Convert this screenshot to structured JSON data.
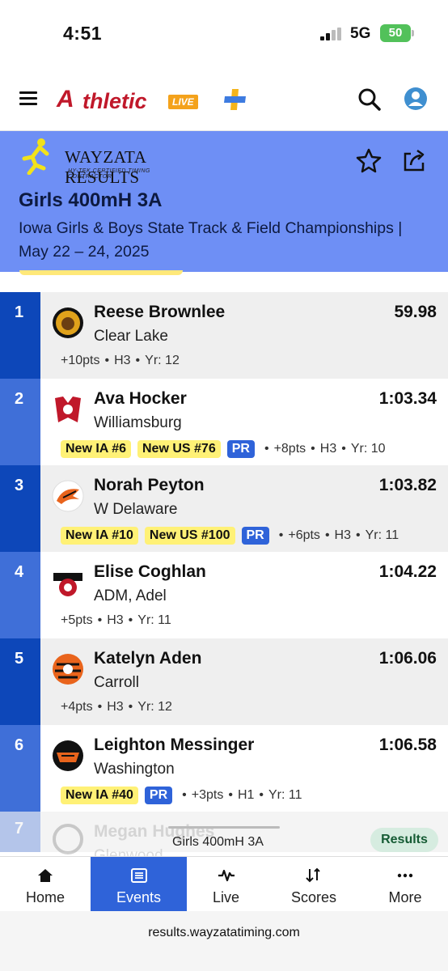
{
  "status_bar": {
    "time": "4:51",
    "network": "5G",
    "battery": "50"
  },
  "app": {
    "logo_a": "A",
    "logo_thletic": "thletic",
    "logo_live": "LIVE"
  },
  "banner": {
    "provider_name": "WAYZATA RESULTS",
    "provider_tagline": "HY-TEK CERTIFIED TIMING CONTRACTOR",
    "event_title": "Girls 400mH 3A",
    "meet_name": "Iowa Girls & Boys State Track & Field Championships | May 22 – 24, 2025"
  },
  "results": [
    {
      "place": "1",
      "athlete": "Reese Brownlee",
      "team": "Clear Lake",
      "mark": "59.98",
      "badges": [],
      "pr": "",
      "pts": "+10pts",
      "heat": "H3",
      "year": "Yr: 12"
    },
    {
      "place": "2",
      "athlete": "Ava Hocker",
      "team": "Williamsburg",
      "mark": "1:03.34",
      "badges": [
        "New IA #6",
        "New US #76"
      ],
      "pr": "PR",
      "pts": "+8pts",
      "heat": "H3",
      "year": "Yr: 10"
    },
    {
      "place": "3",
      "athlete": "Norah Peyton",
      "team": "W Delaware",
      "mark": "1:03.82",
      "badges": [
        "New IA #10",
        "New US #100"
      ],
      "pr": "PR",
      "pts": "+6pts",
      "heat": "H3",
      "year": "Yr: 11"
    },
    {
      "place": "4",
      "athlete": "Elise Coghlan",
      "team": "ADM, Adel",
      "mark": "1:04.22",
      "badges": [],
      "pr": "",
      "pts": "+5pts",
      "heat": "H3",
      "year": "Yr: 11"
    },
    {
      "place": "5",
      "athlete": "Katelyn Aden",
      "team": "Carroll",
      "mark": "1:06.06",
      "badges": [],
      "pr": "",
      "pts": "+4pts",
      "heat": "H3",
      "year": "Yr: 12"
    },
    {
      "place": "6",
      "athlete": "Leighton Messinger",
      "team": "Washington",
      "mark": "1:06.58",
      "badges": [
        "New IA #40"
      ],
      "pr": "PR",
      "pts": "+3pts",
      "heat": "H1",
      "year": "Yr: 11"
    }
  ],
  "partial_row": {
    "place": "7",
    "athlete": "Megan Hughes",
    "team": "Glenwood"
  },
  "mini_bar": {
    "title": "Girls 400mH 3A",
    "results_label": "Results"
  },
  "tabs": [
    {
      "label": "Home",
      "icon": "home-icon"
    },
    {
      "label": "Events",
      "icon": "list-icon"
    },
    {
      "label": "Live",
      "icon": "pulse-icon"
    },
    {
      "label": "Scores",
      "icon": "sort-icon"
    },
    {
      "label": "More",
      "icon": "more-icon"
    }
  ],
  "url": "results.wayzatatiming.com",
  "colors": {
    "accent": "#2f63d9",
    "banner": "#6e8ff5",
    "place_dark": "#0d47b9",
    "place_mid": "#3f6fd8",
    "badge_yellow": "#fff176",
    "brand_red": "#c0182a"
  }
}
